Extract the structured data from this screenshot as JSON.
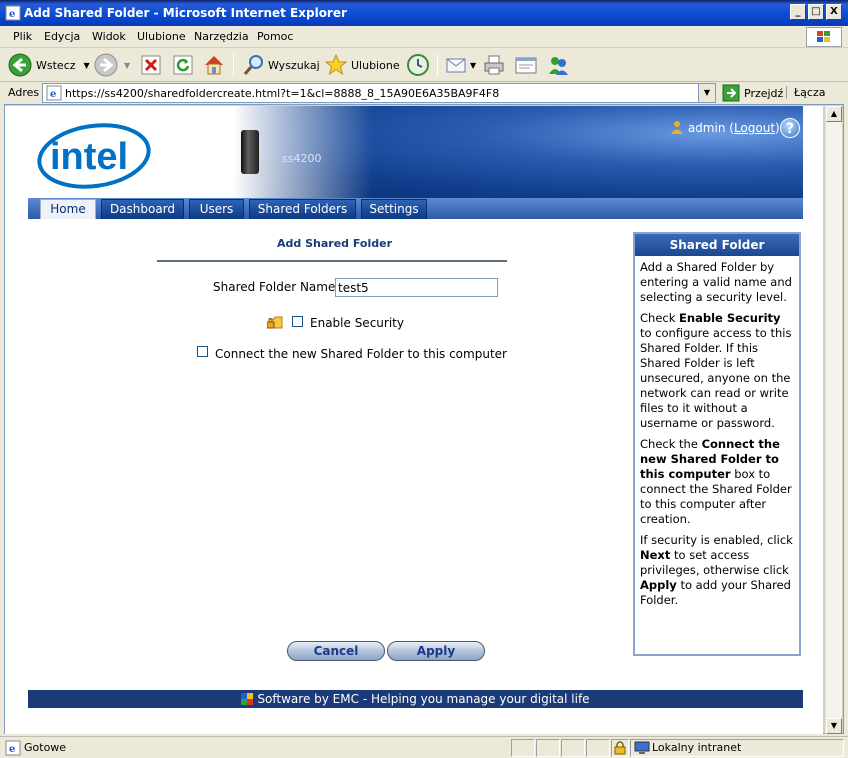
{
  "window": {
    "title": "Add Shared Folder - Microsoft Internet Explorer",
    "controls": {
      "minimize": "_",
      "maximize": "□",
      "close": "X"
    }
  },
  "menu": {
    "items": [
      {
        "label": "Plik",
        "key": "P"
      },
      {
        "label": "Edycja",
        "key": "E"
      },
      {
        "label": "Widok",
        "key": "W"
      },
      {
        "label": "Ulubione",
        "key": "U"
      },
      {
        "label": "Narzędzia",
        "key": "N"
      },
      {
        "label": "Pomoc",
        "key": "c"
      }
    ]
  },
  "toolbar": {
    "back": "Wstecz",
    "search": "Wyszukaj",
    "favorites": "Ulubione",
    "icons": [
      "back-icon",
      "forward-icon",
      "stop-icon",
      "refresh-icon",
      "home-icon",
      "search-icon",
      "favorites-icon",
      "history-icon",
      "mail-icon",
      "print-icon",
      "edit-icon",
      "messenger-icon"
    ]
  },
  "address": {
    "label": "Adres",
    "url": "https://ss4200/sharedfoldercreate.html?t=1&cl=8888_8_15A90E6A35BA9F4F8",
    "go": "Przejdź",
    "links": "Łącza"
  },
  "header": {
    "logo": "intel",
    "device": "ss4200",
    "user": "admin",
    "logout": "Logout",
    "help": "?"
  },
  "tabs": [
    {
      "label": "Home",
      "active": true
    },
    {
      "label": "Dashboard",
      "active": false
    },
    {
      "label": "Users",
      "active": false
    },
    {
      "label": "Shared Folders",
      "active": false
    },
    {
      "label": "Settings",
      "active": false
    }
  ],
  "form": {
    "title": "Add Shared Folder",
    "name_label": "Shared Folder Name:",
    "name_value": "test5",
    "enable_security": "Enable Security",
    "enable_security_checked": false,
    "connect": "Connect the new Shared Folder to this computer",
    "connect_checked": false,
    "cancel": "Cancel",
    "apply": "Apply"
  },
  "help_panel": {
    "title": "Shared Folder",
    "p1": "Add a Shared Folder by entering a valid name and selecting a security level.",
    "p2_a": "Check ",
    "p2_b": "Enable Security",
    "p2_c": " to configure access to this Shared Folder. If this Shared Folder is left unsecured, anyone on the network can read or write files to it without a username or password.",
    "p3_a": "Check the ",
    "p3_b": "Connect the new Shared Folder to this computer",
    "p3_c": " box to connect the Shared Folder to this computer after creation.",
    "p4_a": "If security is enabled, click ",
    "p4_b": "Next",
    "p4_c": " to set access privileges, otherwise click ",
    "p4_d": "Apply",
    "p4_e": " to add your Shared Folder."
  },
  "footer": {
    "text": "Software by EMC - Helping you manage your digital life"
  },
  "status": {
    "text": "Gotowe",
    "zone": "Lokalny intranet"
  },
  "colors": {
    "brand": "#0a2e70",
    "title_bar": "#0a4fd6",
    "chrome": "#ece9d8"
  }
}
